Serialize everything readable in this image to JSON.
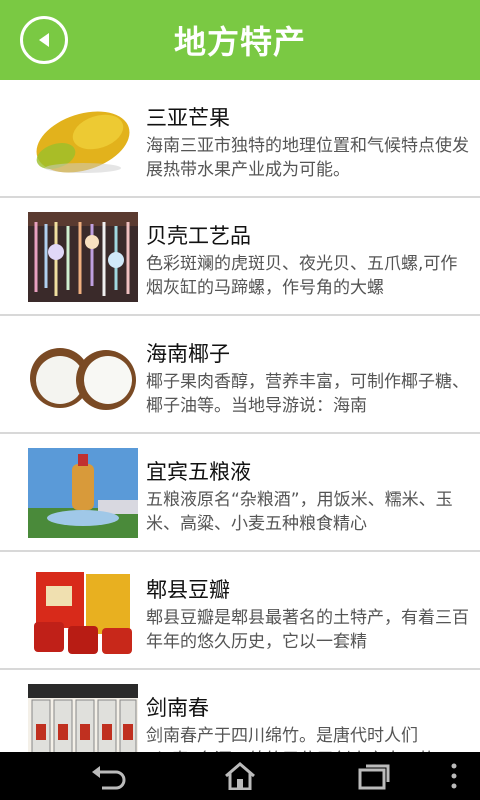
{
  "header": {
    "title": "地方特产"
  },
  "items": [
    {
      "title": "三亚芒果",
      "desc": "海南三亚市独特的地理位置和气候特点使发展热带水果产业成为可能。"
    },
    {
      "title": "贝壳工艺品",
      "desc": "色彩斑斓的虎斑贝、夜光贝、五爪螺,可作烟灰缸的马蹄螺，作号角的大螺"
    },
    {
      "title": "海南椰子",
      "desc": "椰子果肉香醇，营养丰富，可制作椰子糖、椰子油等。当地导游说：海南"
    },
    {
      "title": "宜宾五粮液",
      "desc": "五粮液原名“杂粮酒”，用饭米、糯米、玉米、高粱、小麦五种粮食精心"
    },
    {
      "title": "郫县豆瓣",
      "desc": "郫县豆瓣是郫县最著名的土特产，有着三百年年的悠久历史，它以一套精"
    },
    {
      "title": "剑南春",
      "desc": "剑南春产于四川绵竹。是唐代时人们以“春”名酒，绵竹又位于剑山之南，故"
    }
  ]
}
